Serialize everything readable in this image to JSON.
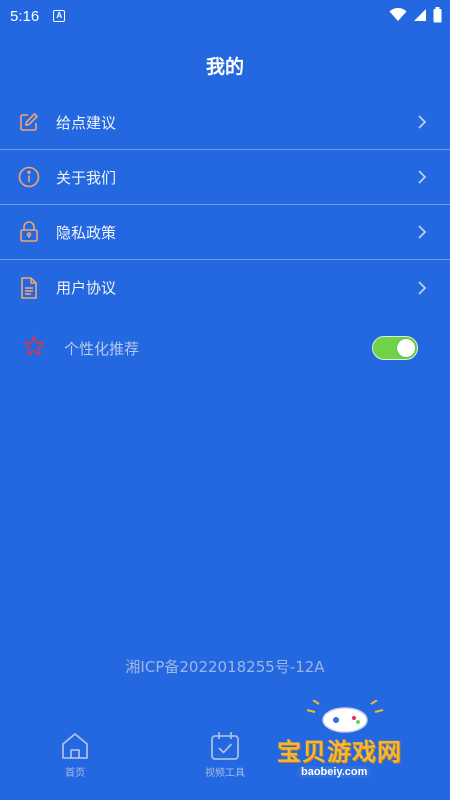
{
  "status_bar": {
    "time": "5:16",
    "notif_letter": "A"
  },
  "header": {
    "title": "我的"
  },
  "menu": [
    {
      "label": "给点建议",
      "icon": "edit-icon"
    },
    {
      "label": "关于我们",
      "icon": "info-icon"
    },
    {
      "label": "隐私政策",
      "icon": "lock-icon"
    },
    {
      "label": "用户协议",
      "icon": "document-icon"
    }
  ],
  "personalized": {
    "label": "个性化推荐",
    "enabled": true,
    "icon": "star-icon"
  },
  "footer": {
    "icp": "湘ICP备2022018255号-12A"
  },
  "bottom_nav": [
    {
      "label": "首页",
      "icon": "home-icon"
    },
    {
      "label": "视频工具",
      "icon": "calendar-check-icon"
    }
  ],
  "watermark": {
    "text": "宝贝游戏网",
    "url": "baobeiy.com"
  },
  "colors": {
    "background": "#2368e0",
    "icon_orange": "#f0a574",
    "toggle_on": "#6fd34a",
    "star_red": "#d8364a"
  }
}
